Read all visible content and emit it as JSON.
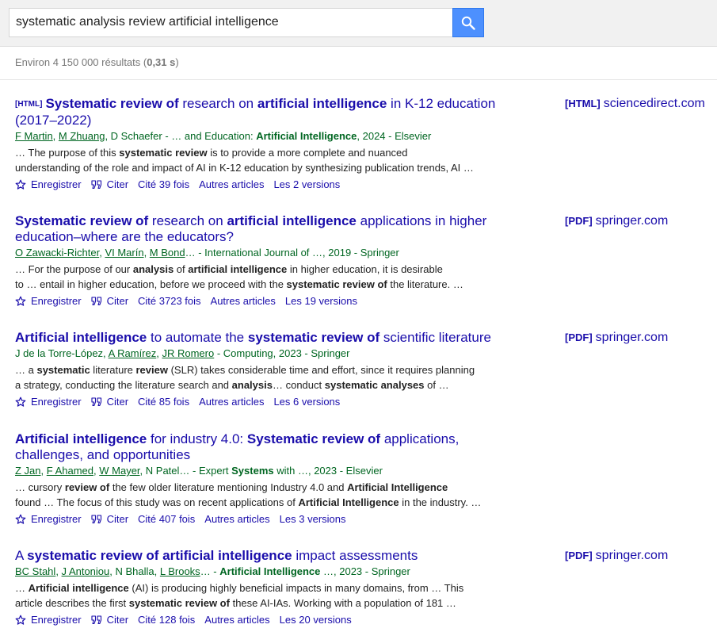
{
  "search": {
    "query": "systematic analysis review artificial intelligence",
    "button_icon": "search-icon"
  },
  "stats": {
    "prefix": "Environ 4 150 000 résultats (",
    "time": "0,31 s",
    "suffix": ")"
  },
  "actions": {
    "save": "Enregistrer",
    "cite": "Citer",
    "related": "Autres articles"
  },
  "results": [
    {
      "tag": "[HTML]",
      "title": [
        {
          "t": "Systematic review of",
          "b": true
        },
        {
          "t": " research on ",
          "b": false
        },
        {
          "t": "artificial intelligence",
          "b": true
        },
        {
          "t": " in K-12 education (2017–2022)",
          "b": false
        }
      ],
      "authors": [
        {
          "t": "F Martin",
          "link": true
        },
        {
          "t": ", ",
          "link": false
        },
        {
          "t": "M Zhuang",
          "link": true
        },
        {
          "t": ", D Schaefer - … and Education: ",
          "link": false
        },
        {
          "t": "Artificial Intelligence",
          "link": false,
          "b": true
        },
        {
          "t": ", 2024 - Elsevier",
          "link": false
        }
      ],
      "snippet": [
        [
          {
            "t": "… The purpose of this ",
            "b": false
          },
          {
            "t": "systematic review",
            "b": true
          },
          {
            "t": " is to provide a more complete and nuanced",
            "b": false
          }
        ],
        [
          {
            "t": "understanding of the role and impact of AI in K-12 education by synthesizing publication trends, AI …",
            "b": false
          }
        ]
      ],
      "cited": "Cité 39 fois",
      "versions": "Les 2 versions",
      "side_tag": "[HTML]",
      "side_source": "sciencedirect.com"
    },
    {
      "tag": "",
      "title": [
        {
          "t": "Systematic review of",
          "b": true
        },
        {
          "t": " research on ",
          "b": false
        },
        {
          "t": "artificial intelligence",
          "b": true
        },
        {
          "t": " applications in higher education–where are the educators?",
          "b": false
        }
      ],
      "authors": [
        {
          "t": "O Zawacki-Richter",
          "link": true
        },
        {
          "t": ", ",
          "link": false
        },
        {
          "t": "VI Marín",
          "link": true
        },
        {
          "t": ", ",
          "link": false
        },
        {
          "t": "M Bond",
          "link": true
        },
        {
          "t": "… - International Journal of …, 2019 - Springer",
          "link": false
        }
      ],
      "snippet": [
        [
          {
            "t": "… For the purpose of our ",
            "b": false
          },
          {
            "t": "analysis",
            "b": true
          },
          {
            "t": " of ",
            "b": false
          },
          {
            "t": "artificial intelligence",
            "b": true
          },
          {
            "t": " in higher education, it is desirable",
            "b": false
          }
        ],
        [
          {
            "t": "to … entail in higher education, before we proceed with the ",
            "b": false
          },
          {
            "t": "systematic review of",
            "b": true
          },
          {
            "t": " the literature. …",
            "b": false
          }
        ]
      ],
      "cited": "Cité 3723 fois",
      "versions": "Les 19 versions",
      "side_tag": "[PDF]",
      "side_source": "springer.com"
    },
    {
      "tag": "",
      "title": [
        {
          "t": "Artificial intelligence",
          "b": true
        },
        {
          "t": " to automate the ",
          "b": false
        },
        {
          "t": "systematic review of",
          "b": true
        },
        {
          "t": " scientific literature",
          "b": false
        }
      ],
      "authors": [
        {
          "t": "J de la Torre-López, ",
          "link": false
        },
        {
          "t": "A Ramírez",
          "link": true
        },
        {
          "t": ", ",
          "link": false
        },
        {
          "t": "JR Romero",
          "link": true
        },
        {
          "t": " - Computing, 2023 - Springer",
          "link": false
        }
      ],
      "snippet": [
        [
          {
            "t": "… a ",
            "b": false
          },
          {
            "t": "systematic",
            "b": true
          },
          {
            "t": " literature ",
            "b": false
          },
          {
            "t": "review",
            "b": true
          },
          {
            "t": " (SLR) takes considerable time and effort, since it requires planning",
            "b": false
          }
        ],
        [
          {
            "t": "a strategy, conducting the literature search and ",
            "b": false
          },
          {
            "t": "analysis",
            "b": true
          },
          {
            "t": "… conduct ",
            "b": false
          },
          {
            "t": "systematic analyses",
            "b": true
          },
          {
            "t": " of …",
            "b": false
          }
        ]
      ],
      "cited": "Cité 85 fois",
      "versions": "Les 6 versions",
      "side_tag": "[PDF]",
      "side_source": "springer.com"
    },
    {
      "tag": "",
      "title": [
        {
          "t": "Artificial intelligence",
          "b": true
        },
        {
          "t": " for industry 4.0: ",
          "b": false
        },
        {
          "t": "Systematic review of",
          "b": true
        },
        {
          "t": " applications, challenges, and opportunities",
          "b": false
        }
      ],
      "authors": [
        {
          "t": "Z Jan",
          "link": true
        },
        {
          "t": ", ",
          "link": false
        },
        {
          "t": "F Ahamed",
          "link": true
        },
        {
          "t": ", ",
          "link": false
        },
        {
          "t": "W Mayer",
          "link": true
        },
        {
          "t": ", N Patel… - Expert ",
          "link": false
        },
        {
          "t": "Systems",
          "link": false,
          "b": true
        },
        {
          "t": " with …, 2023 - Elsevier",
          "link": false
        }
      ],
      "snippet": [
        [
          {
            "t": "… cursory ",
            "b": false
          },
          {
            "t": "review of",
            "b": true
          },
          {
            "t": " the few older literature mentioning Industry 4.0 and ",
            "b": false
          },
          {
            "t": "Artificial Intelligence",
            "b": true
          }
        ],
        [
          {
            "t": "found … The focus of this study was on recent applications of ",
            "b": false
          },
          {
            "t": "Artificial Intelligence",
            "b": true
          },
          {
            "t": " in the industry. …",
            "b": false
          }
        ]
      ],
      "cited": "Cité 407 fois",
      "versions": "Les 3 versions",
      "side_tag": "",
      "side_source": ""
    },
    {
      "tag": "",
      "title": [
        {
          "t": "A ",
          "b": false
        },
        {
          "t": "systematic review of artificial intelligence",
          "b": true
        },
        {
          "t": " impact assessments",
          "b": false
        }
      ],
      "authors": [
        {
          "t": "BC Stahl",
          "link": true
        },
        {
          "t": ", ",
          "link": false
        },
        {
          "t": "J Antoniou",
          "link": true
        },
        {
          "t": ", N Bhalla, ",
          "link": false
        },
        {
          "t": "L Brooks",
          "link": true
        },
        {
          "t": "… - ",
          "link": false
        },
        {
          "t": "Artificial Intelligence",
          "link": false,
          "b": true
        },
        {
          "t": " …, 2023 - Springer",
          "link": false
        }
      ],
      "snippet": [
        [
          {
            "t": "… ",
            "b": false
          },
          {
            "t": "Artificial intelligence",
            "b": true
          },
          {
            "t": " (AI) is producing highly beneficial impacts in many domains, from … This",
            "b": false
          }
        ],
        [
          {
            "t": "article describes the first ",
            "b": false
          },
          {
            "t": "systematic review of",
            "b": true
          },
          {
            "t": " these AI-IAs. Working with a population of 181 …",
            "b": false
          }
        ]
      ],
      "cited": "Cité 128 fois",
      "versions": "Les 20 versions",
      "side_tag": "[PDF]",
      "side_source": "springer.com"
    }
  ],
  "colors": {
    "link": "#1a0dab",
    "green": "#006621",
    "search_button": "#4d90fe",
    "topbar": "#f1f1f1"
  }
}
